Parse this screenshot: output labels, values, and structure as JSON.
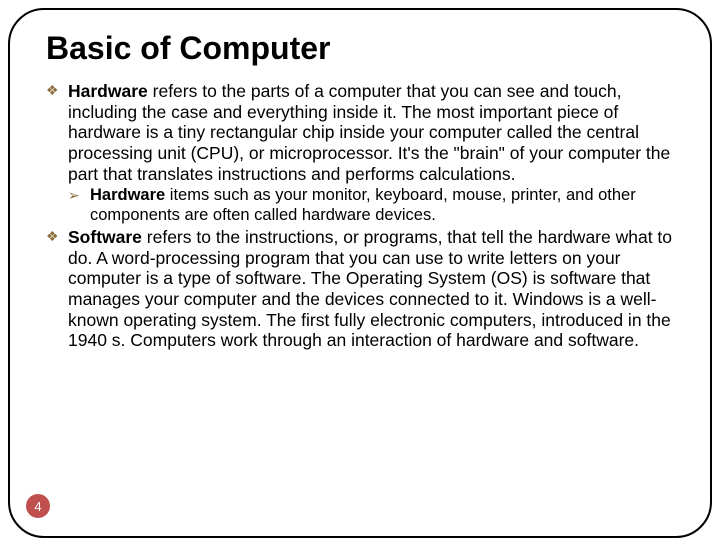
{
  "title": "Basic of Computer",
  "page_number": "4",
  "bullets": {
    "hw_lead_bold": "Hardware",
    "hw_lead_rest": " refers to the parts of a computer that you can see and touch, including the case and everything inside it. The most important piece of hardware is a tiny rectangular chip inside your computer called the central processing unit (CPU), or microprocessor. It's the \"brain\" of your computer the part that translates instructions and performs calculations.",
    "hw_sub_bold": "Hardware",
    "hw_sub_rest": " items such as your monitor, keyboard, mouse, printer, and other components are often called hardware devices.",
    "sw_lead_bold": "Software",
    "sw_lead_rest": " refers to the instructions, or programs, that tell the hardware what to do. A word-processing program that you can use to write letters on your computer is a type of software. The Operating System (OS) is software that manages your computer and the devices connected to it. Windows is a well-known operating system. The first fully electronic computers, introduced in the 1940 s. Computers work through an interaction of hardware and software."
  }
}
